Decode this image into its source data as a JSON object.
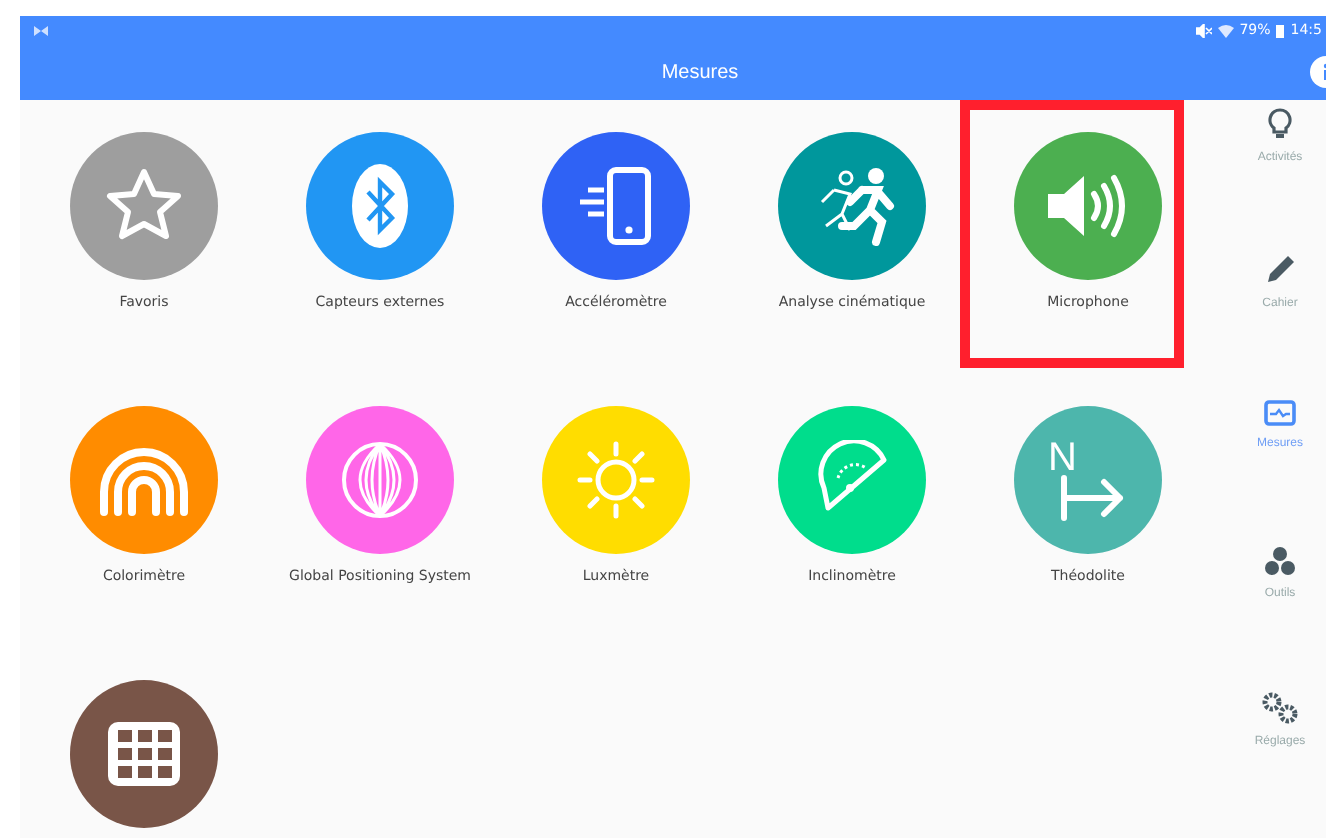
{
  "status_bar": {
    "battery": "79%",
    "time": "14:5"
  },
  "app_bar": {
    "title": "Mesures"
  },
  "tiles": [
    {
      "label": "Favoris",
      "color": "#9e9e9e",
      "highlighted": false
    },
    {
      "label": "Capteurs externes",
      "color": "#2196f3",
      "highlighted": false
    },
    {
      "label": "Accéléromètre",
      "color": "#2f62f5",
      "highlighted": false
    },
    {
      "label": "Analyse cinématique",
      "color": "#00979c",
      "highlighted": false
    },
    {
      "label": "Microphone",
      "color": "#4caf50",
      "highlighted": true
    },
    {
      "label": "Colorimètre",
      "color": "#ff8c00",
      "highlighted": false
    },
    {
      "label": "Global Positioning System",
      "color": "#ff66e8",
      "highlighted": false
    },
    {
      "label": "Luxmètre",
      "color": "#ffdd00",
      "highlighted": false
    },
    {
      "label": "Inclinomètre",
      "color": "#00dd8c",
      "highlighted": false
    },
    {
      "label": "Théodolite",
      "color": "#4db6ac",
      "highlighted": false,
      "icon_letter": "N"
    },
    {
      "color": "#795548",
      "highlighted": false
    }
  ],
  "sidebar": {
    "items": [
      {
        "label": "Activités",
        "selected": false
      },
      {
        "label": "Cahier",
        "selected": false
      },
      {
        "label": "Mesures",
        "selected": true
      },
      {
        "label": "Outils",
        "selected": false
      },
      {
        "label": "Réglages",
        "selected": false
      }
    ]
  }
}
